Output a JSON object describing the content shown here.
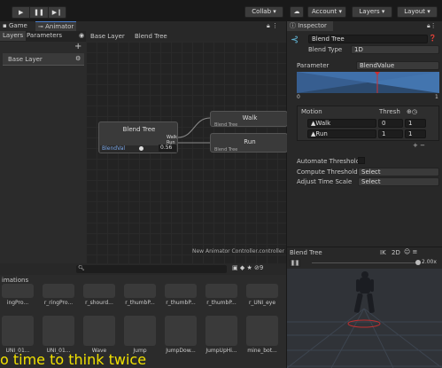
{
  "toolbar": {
    "collab": "Collab ▾",
    "account": "Account",
    "layers": "Layers",
    "layout": "Layout"
  },
  "tabs": {
    "game": "Game",
    "animator": "Animator",
    "inspector": "Inspector"
  },
  "animator": {
    "layers_tab": "Layers",
    "parameters_tab": "Parameters",
    "base_layer": "Base Layer",
    "breadcrumb": [
      "Base Layer",
      "Blend Tree"
    ],
    "node_blend_tree": "Blend Tree",
    "node_param": "BlendVal",
    "node_value": "0.56",
    "node_out1": "Walk",
    "node_out2": "Run",
    "child1_title": "Walk",
    "child1_sub": "Blend Tree",
    "child2_title": "Run",
    "child2_sub": "Blend Tree",
    "footer": "New Animator Controller.controller"
  },
  "inspector": {
    "name": "Blend Tree",
    "blend_type_label": "Blend Type",
    "blend_type_value": "1D",
    "parameter_label": "Parameter",
    "parameter_value": "BlendValue",
    "graph_min": "0",
    "graph_max": "1",
    "motion_header": "Motion",
    "thresh_header": "Thresh",
    "motions": [
      {
        "name": "Walk",
        "thresh": "0",
        "speed": "1"
      },
      {
        "name": "Run",
        "thresh": "1",
        "speed": "1"
      }
    ],
    "auto_thresholds": "Automate Thresholds",
    "compute_thresholds": "Compute Thresholds",
    "compute_value": "Select",
    "adjust_time": "Adjust Time Scale",
    "adjust_value": "Select"
  },
  "preview": {
    "title": "Blend Tree",
    "ik": "IK",
    "twod": "2D",
    "speed": "2.00x"
  },
  "assets": {
    "header": "imations",
    "row1": [
      "ingPro...",
      "r_ringPro...",
      "r_shourd...",
      "r_thumbP...",
      "r_thumbP...",
      "r_thumbP...",
      "r_UNI_eye"
    ],
    "row2": [
      "UNI_01...",
      "UNI_01...",
      "Wave",
      "Jump",
      "JumpDow...",
      "JumpUpHi...",
      "mine_bot..."
    ]
  },
  "subtitle": "o time to think twice"
}
